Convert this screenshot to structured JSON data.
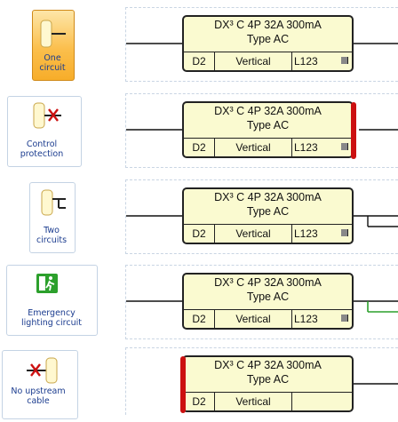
{
  "buttons": [
    {
      "label_lines": [
        "One",
        "circuit"
      ],
      "icon": "one-circuit-icon",
      "active": true
    },
    {
      "label_lines": [
        "Control",
        "protection"
      ],
      "icon": "control-protection-icon",
      "active": false
    },
    {
      "label_lines": [
        "Two",
        "circuits"
      ],
      "icon": "two-circuits-icon",
      "active": false
    },
    {
      "label_lines": [
        "Emergency",
        "lighting circuit"
      ],
      "icon": "emergency-lighting-icon",
      "active": false
    },
    {
      "label_lines": [
        "No upstream",
        "cable"
      ],
      "icon": "no-upstream-cable-icon",
      "active": false
    }
  ],
  "device": {
    "line1": "DX³ C 4P 32A 300mA",
    "line2": "Type AC",
    "cell_d": "D2",
    "cell_orientation": "Vertical",
    "cell_phase": "L123"
  },
  "colors": {
    "accent_active": "#fbbf4d",
    "protection_bar": "#cc1010",
    "emergency_green": "#2ca02c",
    "label_blue": "#1b3c8f"
  }
}
